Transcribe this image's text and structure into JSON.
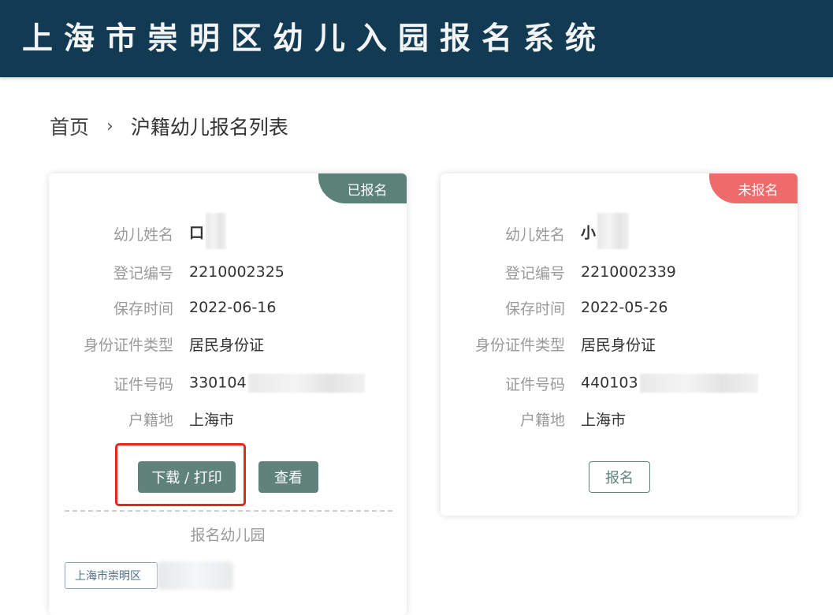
{
  "header": {
    "title": "上海市崇明区幼儿入园报名系统"
  },
  "breadcrumb": {
    "home": "首页",
    "separator": "›",
    "current": "沪籍幼儿报名列表"
  },
  "cards": [
    {
      "status": "已报名",
      "status_color": "#5b8179",
      "fields": [
        {
          "label": "幼儿姓名",
          "value": "口"
        },
        {
          "label": "登记编号",
          "value": "2210002325"
        },
        {
          "label": "保存时间",
          "value": "2022-06-16"
        },
        {
          "label": "身份证件类型",
          "value": "居民身份证"
        },
        {
          "label": "证件号码",
          "value": "330104"
        },
        {
          "label": "户籍地",
          "value": "上海市"
        }
      ],
      "buttons": {
        "download_print": "下载 / 打印",
        "view": "查看"
      },
      "enrolled_section": {
        "title": "报名幼儿园",
        "tag": "上海市崇明区"
      }
    },
    {
      "status": "未报名",
      "status_color": "#ef6b6b",
      "fields": [
        {
          "label": "幼儿姓名",
          "value": "小"
        },
        {
          "label": "登记编号",
          "value": "2210002339"
        },
        {
          "label": "保存时间",
          "value": "2022-05-26"
        },
        {
          "label": "身份证件类型",
          "value": "居民身份证"
        },
        {
          "label": "证件号码",
          "value": "440103"
        },
        {
          "label": "户籍地",
          "value": "上海市"
        }
      ],
      "buttons": {
        "register": "报名"
      }
    }
  ],
  "colors": {
    "header_bg": "#123a52",
    "primary_button": "#5f837b",
    "highlight": "#e8261f"
  }
}
